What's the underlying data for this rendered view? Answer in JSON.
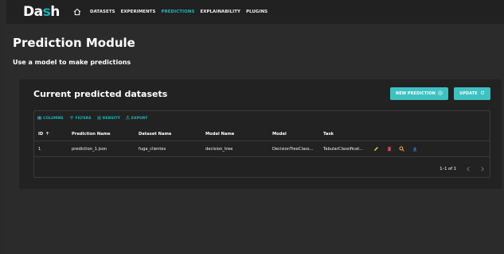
{
  "app": {
    "logo_main": "Da",
    "logo_accent": "s",
    "logo_end": "h"
  },
  "nav": {
    "items": [
      {
        "label": "DATASETS",
        "active": false
      },
      {
        "label": "EXPERIMENTS",
        "active": false
      },
      {
        "label": "PREDICTIONS",
        "active": true
      },
      {
        "label": "EXPLAINABILITY",
        "active": false
      },
      {
        "label": "PLUGINS",
        "active": false
      }
    ]
  },
  "page": {
    "title": "Prediction Module",
    "subtitle": "Use a model to make predictions"
  },
  "card": {
    "title": "Current predicted datasets",
    "new_button": "NEW PREDICTION",
    "update_button": "UPDATE"
  },
  "toolbar": {
    "columns": "COLUMNS",
    "filters": "FILTERS",
    "density": "DENSITY",
    "export": "EXPORT"
  },
  "table": {
    "headers": {
      "id": "ID",
      "prediction_name": "Prediction Name",
      "dataset_name": "Dataset Name",
      "model_name": "Model Name",
      "model": "Model",
      "task": "Task"
    },
    "rows": [
      {
        "id": "1",
        "prediction_name": "prediction_1.json",
        "dataset_name": "fuga_clientes",
        "model_name": "decision_tree",
        "model": "DecisionTreeClass...",
        "task": "TabularClassificat..."
      }
    ],
    "pagination": "1–1 of 1"
  },
  "colors": {
    "accent": "#1fb4b8",
    "button": "#3fc1c2",
    "edit": "#f5c33b",
    "delete": "#e0476b",
    "search": "#f5c33b",
    "download": "#3a8de0"
  }
}
